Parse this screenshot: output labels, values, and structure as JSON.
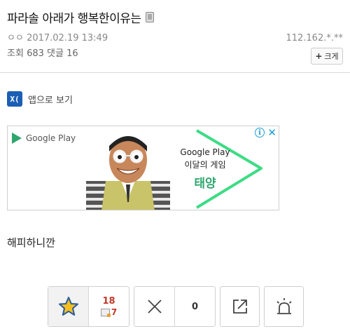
{
  "post": {
    "title": "파라솔 아래가 행복한이유는",
    "author": "ㅇㅇ",
    "datetime": "2017.02.19 13:49",
    "views_label": "조회",
    "views": "683",
    "comments_label": "댓글",
    "comments": "16",
    "ip": "112.162.*.**",
    "font_size_button": "크게",
    "body": "해피하니깐"
  },
  "app_link": {
    "label": "앱으로 보기",
    "logo_text": "X("
  },
  "ad": {
    "store_name": "Google Play",
    "line1": "Google Play",
    "line2": "이달의 게임",
    "line3": "태양",
    "brand_green": "#2fa66e"
  },
  "actions": {
    "recommend_count": "18",
    "fixed_recommend_count": "7",
    "not_recommend_count": "0"
  },
  "icons": [
    "mobile-icon",
    "app-logo-icon",
    "google-play-icon",
    "info-icon",
    "close-icon",
    "star-icon",
    "x-icon",
    "share-icon",
    "siren-icon"
  ]
}
